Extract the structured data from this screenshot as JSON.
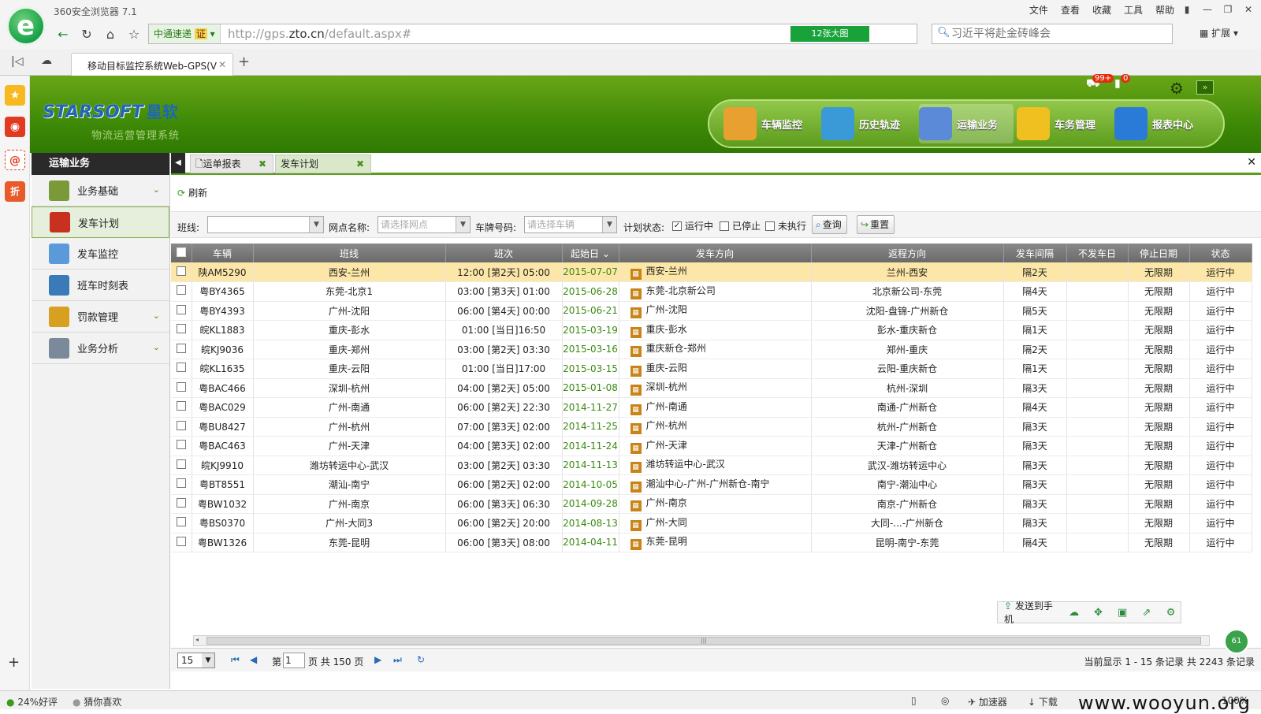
{
  "browser": {
    "app_title": "360安全浏览器 7.1",
    "menu": [
      "文件",
      "查看",
      "收藏",
      "工具",
      "帮助"
    ],
    "cert_label": "中通速递",
    "cert_badge": "证",
    "url_prefix": "http://gps.",
    "url_domain": "zto.cn",
    "url_path": "/default.aspx#",
    "bigimg_label": "12张大图",
    "search_placeholder": "习近平将赴金砖峰会",
    "ext_label": "扩展",
    "tab_title": "移动目标监控系统Web-GPS(V",
    "status_rating": "24%好评",
    "status_like": "猜你喜欢",
    "status_accel": "加速器",
    "status_download": "下载",
    "status_zoom": "100%",
    "watermark": "www.wooyun.org"
  },
  "header": {
    "brand_en": "STARSOFT",
    "brand_cn": "星软",
    "brand_sub": "物流运营管理系统",
    "badge_cart": "99+",
    "badge_chart": "0",
    "modules": [
      {
        "label": "车辆监控",
        "color": "#e8a030"
      },
      {
        "label": "历史轨迹",
        "color": "#3a9ad8"
      },
      {
        "label": "运输业务",
        "color": "#5a8ad8"
      },
      {
        "label": "车务管理",
        "color": "#f0c020"
      },
      {
        "label": "报表中心",
        "color": "#2a7ad8"
      }
    ]
  },
  "leftmenu": {
    "title": "运输业务",
    "items": [
      {
        "label": "业务基础",
        "icon_color": "#7a9a3a",
        "expand": true
      },
      {
        "label": "发车计划",
        "icon_color": "#c83020",
        "expand": false
      },
      {
        "label": "发车监控",
        "icon_color": "#5a9ad8",
        "expand": false
      },
      {
        "label": "班车时刻表",
        "icon_color": "#3a7ab8",
        "expand": false
      },
      {
        "label": "罚款管理",
        "icon_color": "#d8a020",
        "expand": true
      },
      {
        "label": "业务分析",
        "icon_color": "#7a8a9a",
        "expand": true
      }
    ]
  },
  "tabs": {
    "items": [
      "运单报表",
      "发车计划"
    ],
    "refresh": "刷新"
  },
  "filters": {
    "route_label": "班线:",
    "site_label": "网点名称:",
    "site_placeholder": "请选择网点",
    "plate_label": "车牌号码:",
    "plate_placeholder": "请选择车辆",
    "status_label": "计划状态:",
    "status_options": [
      "运行中",
      "已停止",
      "未执行"
    ],
    "query": "查询",
    "reset": "重置"
  },
  "table": {
    "columns": [
      "车辆",
      "班线",
      "班次",
      "起始日",
      "发车方向",
      "返程方向",
      "发车间隔",
      "不发车日",
      "停止日期",
      "状态"
    ],
    "rows": [
      [
        "陕AM5290",
        "西安-兰州",
        "12:00 [第2天] 05:00",
        "2015-07-07",
        "西安-兰州",
        "兰州-西安",
        "隔2天",
        "",
        "无限期",
        "运行中"
      ],
      [
        "粤BY4365",
        "东莞-北京1",
        "03:00 [第3天] 01:00",
        "2015-06-28",
        "东莞-北京新公司",
        "北京新公司-东莞",
        "隔4天",
        "",
        "无限期",
        "运行中"
      ],
      [
        "粤BY4393",
        "广州-沈阳",
        "06:00 [第4天] 00:00",
        "2015-06-21",
        "广州-沈阳",
        "沈阳-盘锦-广州新仓",
        "隔5天",
        "",
        "无限期",
        "运行中"
      ],
      [
        "皖KL1883",
        "重庆-彭水",
        "01:00 [当日]16:50",
        "2015-03-19",
        "重庆-彭水",
        "彭水-重庆新仓",
        "隔1天",
        "",
        "无限期",
        "运行中"
      ],
      [
        "皖KJ9036",
        "重庆-郑州",
        "03:00 [第2天] 03:30",
        "2015-03-16",
        "重庆新仓-郑州",
        "郑州-重庆",
        "隔2天",
        "",
        "无限期",
        "运行中"
      ],
      [
        "皖KL1635",
        "重庆-云阳",
        "01:00 [当日]17:00",
        "2015-03-15",
        "重庆-云阳",
        "云阳-重庆新仓",
        "隔1天",
        "",
        "无限期",
        "运行中"
      ],
      [
        "粤BAC466",
        "深圳-杭州",
        "04:00 [第2天] 05:00",
        "2015-01-08",
        "深圳-杭州",
        "杭州-深圳",
        "隔3天",
        "",
        "无限期",
        "运行中"
      ],
      [
        "粤BAC029",
        "广州-南通",
        "06:00 [第2天] 22:30",
        "2014-11-27",
        "广州-南通",
        "南通-广州新仓",
        "隔4天",
        "",
        "无限期",
        "运行中"
      ],
      [
        "粤BU8427",
        "广州-杭州",
        "07:00 [第3天] 02:00",
        "2014-11-25",
        "广州-杭州",
        "杭州-广州新仓",
        "隔3天",
        "",
        "无限期",
        "运行中"
      ],
      [
        "粤BAC463",
        "广州-天津",
        "04:00 [第3天] 02:00",
        "2014-11-24",
        "广州-天津",
        "天津-广州新仓",
        "隔3天",
        "",
        "无限期",
        "运行中"
      ],
      [
        "皖KJ9910",
        "潍坊转运中心-武汉",
        "03:00 [第2天] 03:30",
        "2014-11-13",
        "潍坊转运中心-武汉",
        "武汉-潍坊转运中心",
        "隔3天",
        "",
        "无限期",
        "运行中"
      ],
      [
        "粤BT8551",
        "潮汕-南宁",
        "06:00 [第2天] 02:00",
        "2014-10-05",
        "潮汕中心-广州-广州新仓-南宁",
        "南宁-潮汕中心",
        "隔3天",
        "",
        "无限期",
        "运行中"
      ],
      [
        "粤BW1032",
        "广州-南京",
        "06:00 [第3天] 06:30",
        "2014-09-28",
        "广州-南京",
        "南京-广州新仓",
        "隔3天",
        "",
        "无限期",
        "运行中"
      ],
      [
        "粤BS0370",
        "广州-大同3",
        "06:00 [第2天] 20:00",
        "2014-08-13",
        "广州-大同",
        "大同-...-广州新仓",
        "隔3天",
        "",
        "无限期",
        "运行中"
      ],
      [
        "粤BW1326",
        "东莞-昆明",
        "06:00 [第3天] 08:00",
        "2014-04-11",
        "东莞-昆明",
        "昆明-南宁-东莞",
        "隔4天",
        "",
        "无限期",
        "运行中"
      ]
    ]
  },
  "floatbar": {
    "send_label": "发送到手机"
  },
  "pager": {
    "page_size": "15",
    "page_prefix": "第",
    "page_value": "1",
    "page_suffix": "页 共 150 页",
    "info": "当前显示 1 - 15 条记录 共 2243 条记录",
    "badge": "61"
  }
}
